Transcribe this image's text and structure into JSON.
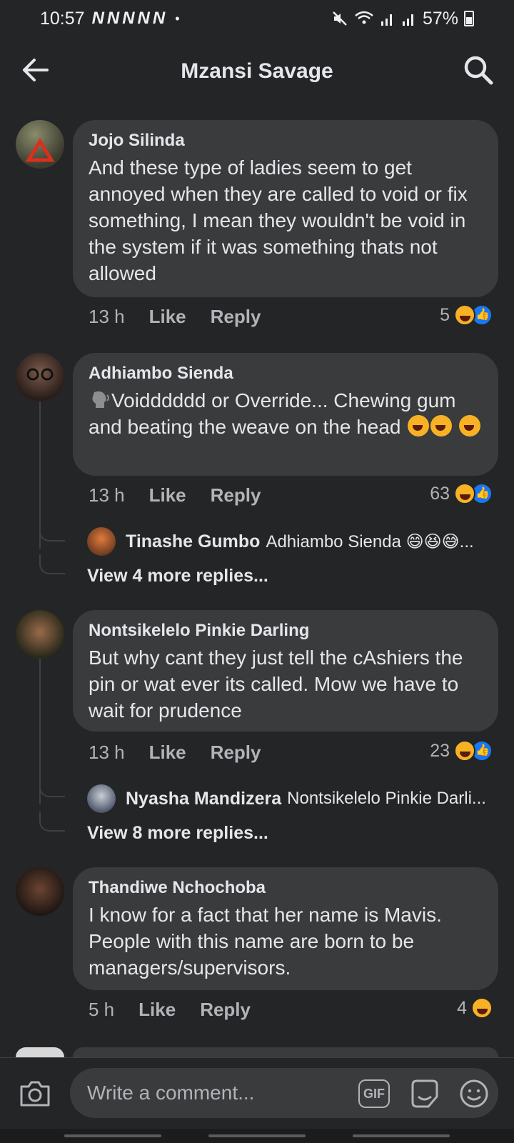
{
  "status_bar": {
    "time": "10:57",
    "notifications": "NNNNN",
    "dot": "•",
    "battery": "57%"
  },
  "header": {
    "title": "Mzansi Savage"
  },
  "comments": [
    {
      "author": "Jojo Silinda",
      "text": "And these type of ladies seem to get annoyed when they are called to void or fix something, I mean they wouldn't be void in the system if it was  something thats not allowed",
      "time": "13 h",
      "like": "Like",
      "reply": "Reply",
      "reaction_count": "5"
    },
    {
      "author": "Adhiambo Sienda",
      "text": "Voidddddd or Override... Chewing gum and beating the weave on the head",
      "time": "13 h",
      "like": "Like",
      "reply": "Reply",
      "reaction_count": "63",
      "reply_preview": {
        "name": "Tinashe Gumbo",
        "text": "Adhiambo Sienda 😄😆😅..."
      },
      "view_more": "View 4 more replies..."
    },
    {
      "author": "Nontsikelelo Pinkie Darling",
      "text": "But why cant they just tell the cAshiers the pin or wat ever its called. Mow we have to wait for prudence",
      "time": "13 h",
      "like": "Like",
      "reply": "Reply",
      "reaction_count": "23",
      "reply_preview": {
        "name": "Nyasha Mandizera",
        "text": "Nontsikelelo Pinkie Darli..."
      },
      "view_more": "View 8 more replies..."
    },
    {
      "author": "Thandiwe Nchochoba",
      "text": "I know for a fact that her name is Mavis. People with this name are born to be managers/supervisors.",
      "time": "5 h",
      "like": "Like",
      "reply": "Reply",
      "reaction_count": "4"
    }
  ],
  "composer": {
    "placeholder": "Write a comment...",
    "gif_label": "GIF"
  },
  "icons": {
    "back": "arrow-left-icon",
    "search": "search-icon",
    "camera": "camera-icon",
    "gif": "gif-icon",
    "sticker": "sticker-icon",
    "emoji": "emoji-icon"
  },
  "colors": {
    "background": "#242526",
    "bubble": "#3a3b3c",
    "text_primary": "#e4e6eb",
    "text_secondary": "#b0b3b8",
    "like_blue": "#1877f2",
    "haha_yellow": "#f7b125"
  }
}
